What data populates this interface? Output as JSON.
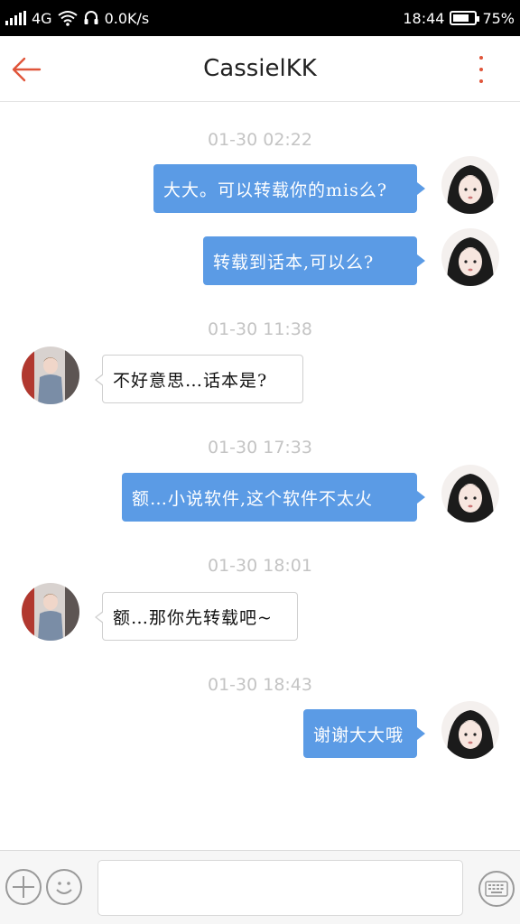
{
  "status_bar": {
    "network": "4G",
    "speed": "0.0K/s",
    "time": "18:44",
    "battery": "75%",
    "battery_level": 0.75
  },
  "header": {
    "title": "CassielKK",
    "back_icon": "arrow-left-icon",
    "menu_icon": "more-vertical-icon",
    "accent": "#e0553a"
  },
  "messages": [
    {
      "time": "01-30 02:22",
      "side": "out",
      "text": "大大。可以转载你的mis么?"
    },
    {
      "side": "out",
      "text": "转载到话本,可以么?"
    },
    {
      "time": "01-30 11:38",
      "side": "in",
      "text": "不好意思…话本是?"
    },
    {
      "time": "01-30 17:33",
      "side": "out",
      "text": "额…小说软件,这个软件不太火"
    },
    {
      "time": "01-30 18:01",
      "side": "in",
      "text": "额…那你先转载吧~"
    },
    {
      "time": "01-30 18:43",
      "side": "out",
      "text": "谢谢大大哦"
    }
  ],
  "colors": {
    "outgoing_bubble": "#5b9be5",
    "incoming_border": "#cfcfcf",
    "timestamp": "#c4c4c4"
  },
  "input_bar": {
    "add_icon": "plus-circle-icon",
    "emoji_icon": "smiley-icon",
    "keyboard_icon": "keyboard-icon",
    "placeholder": ""
  }
}
